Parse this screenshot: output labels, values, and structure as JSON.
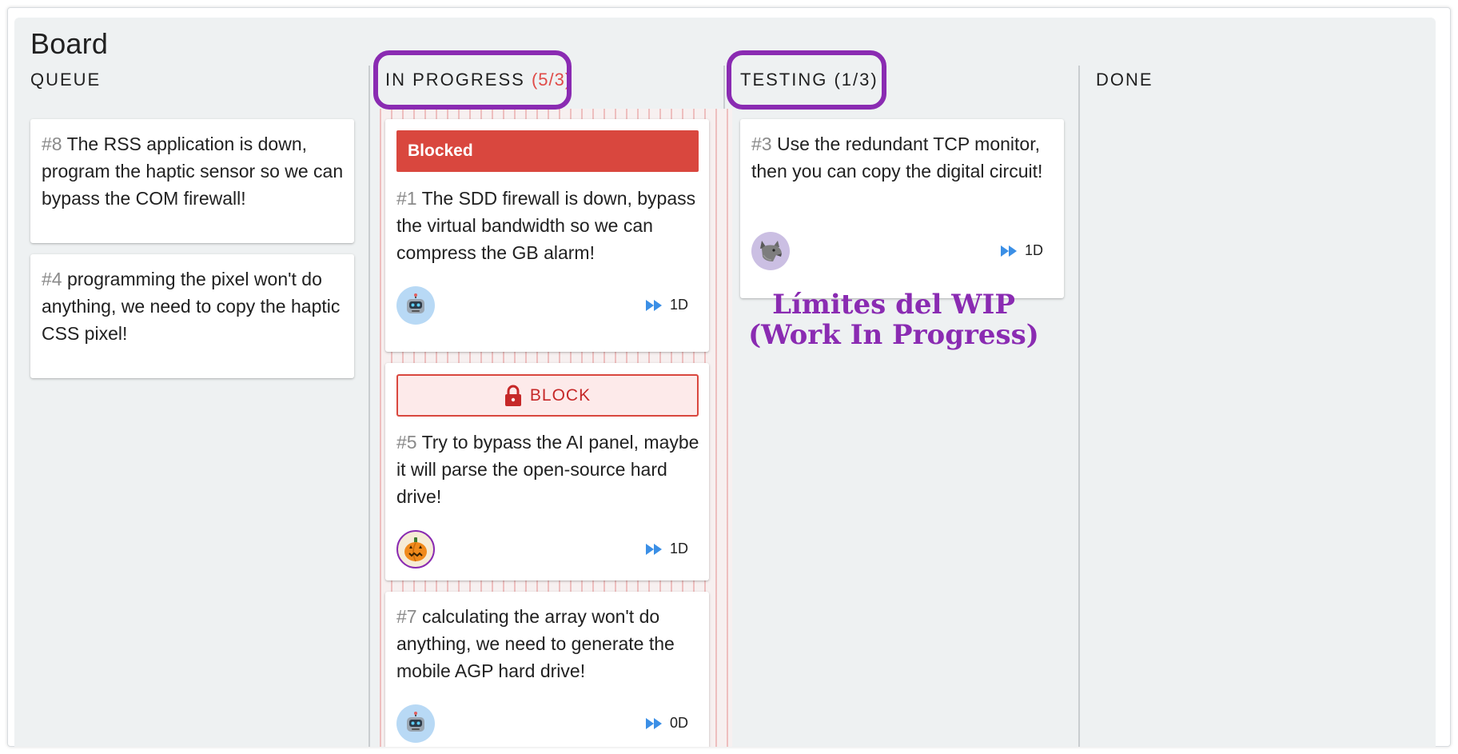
{
  "board": {
    "title": "Board"
  },
  "columns": {
    "queue": {
      "title": "QUEUE"
    },
    "in_progress": {
      "title": "IN PROGRESS",
      "count": "(5/3)"
    },
    "testing": {
      "title": "TESTING (1/3)"
    },
    "done": {
      "title": "DONE"
    }
  },
  "cards": {
    "c8": {
      "id": "#8",
      "text": " The RSS application is down, program the haptic sensor so we can bypass the COM firewall!"
    },
    "c4": {
      "id": "#4",
      "text": " programming the pixel won't do anything, we need to copy the haptic CSS pixel!"
    },
    "c1": {
      "status": "Blocked",
      "id": "#1",
      "text": " The SDD firewall is down, bypass the virtual bandwidth so we can compress the GB alarm!",
      "avatar": "robot-avatar",
      "estimate": "1D"
    },
    "c5": {
      "block_label": "BLOCK",
      "id": "#5",
      "text": " Try to bypass the AI panel, maybe it will parse the open-source hard drive!",
      "avatar": "pumpkin-avatar",
      "estimate": "1D"
    },
    "c7": {
      "id": "#7",
      "text": " calculating the array won't do anything, we need to generate the mobile AGP hard drive!",
      "avatar": "robot-avatar",
      "estimate": "0D"
    },
    "c3": {
      "id": "#3",
      "text": " Use the redundant TCP monitor, then you can copy the digital circuit!",
      "avatar": "wolf-avatar",
      "estimate": "1D"
    }
  },
  "annotation": {
    "line1": "Límites del WIP",
    "line2": "(Work In Progress)"
  },
  "colors": {
    "highlight": "#8a2bb2",
    "blocked": "#d9473e",
    "over_limit": "#e04b48",
    "estimate_icon": "#3b8fe6"
  },
  "icons": [
    "lock-icon",
    "fast-forward-icon",
    "robot-icon",
    "pumpkin-icon",
    "wolf-icon"
  ]
}
